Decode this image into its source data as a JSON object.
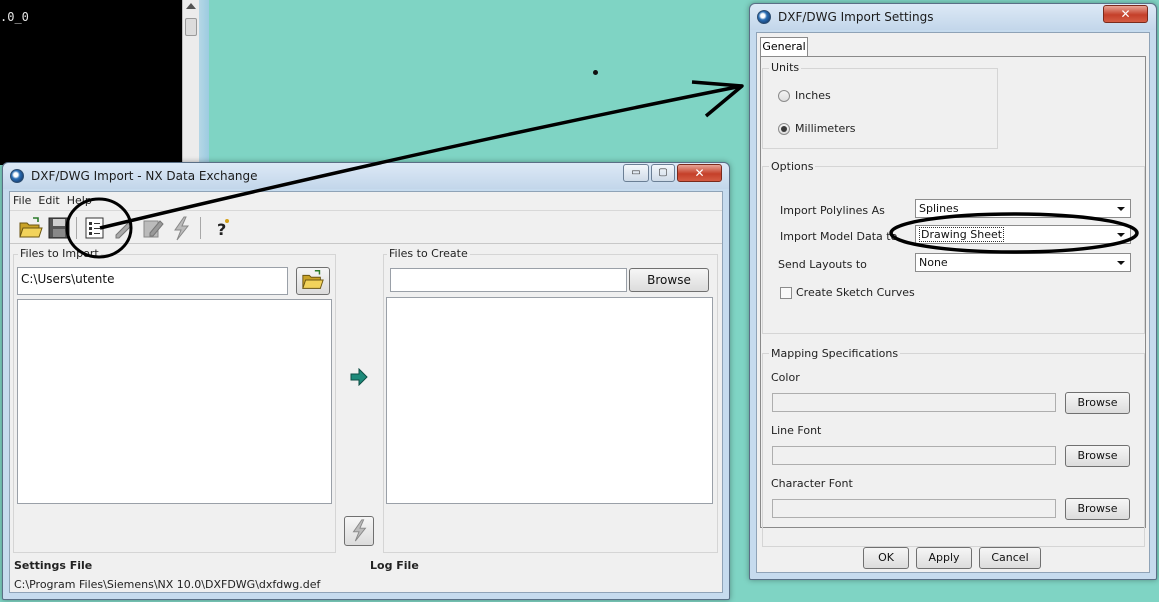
{
  "console": {
    "text": ".0_0"
  },
  "main_window": {
    "title": "DXF/DWG Import - NX Data Exchange",
    "controls": {
      "minimize": "▭",
      "maximize": "▢",
      "close": "✕"
    },
    "menu": [
      "File",
      "Edit",
      "Help"
    ],
    "toolbar_icons": [
      "open-folder-icon",
      "save-icon",
      "settings-sheet-icon",
      "edit-icon",
      "edit-pencil-icon",
      "run-lightning-icon",
      "help-icon"
    ],
    "files_to_import": {
      "label": "Files to Import",
      "path": "C:\\Users\\utente"
    },
    "files_to_create": {
      "label": "Files to Create",
      "path": "",
      "browse_label": "Browse"
    },
    "settings_file": {
      "label": "Settings File",
      "path": "C:\\Program Files\\Siemens\\NX 10.0\\DXFDWG\\dxfdwg.def"
    },
    "log_file": {
      "label": "Log File"
    }
  },
  "settings_dialog": {
    "title": "DXF/DWG Import Settings",
    "tab": "General",
    "units": {
      "label": "Units",
      "options": [
        "Inches",
        "Millimeters"
      ],
      "selected": "Millimeters"
    },
    "options": {
      "label": "Options",
      "import_polylines_label": "Import Polylines As",
      "import_polylines_value": "Splines",
      "import_model_label": "Import Model Data to",
      "import_model_value": "Drawing Sheet",
      "send_layouts_label": "Send Layouts to",
      "send_layouts_value": "None",
      "create_sketch_label": "Create Sketch Curves",
      "create_sketch_checked": false
    },
    "mapping": {
      "label": "Mapping Specifications",
      "color_label": "Color",
      "line_font_label": "Line Font",
      "character_font_label": "Character Font",
      "browse_label": "Browse"
    },
    "buttons": {
      "ok": "OK",
      "apply": "Apply",
      "cancel": "Cancel"
    }
  },
  "colors": {
    "desktop": "#7fd4c4",
    "arrow_icon": "#1d8a7a",
    "annotation": "#000000"
  }
}
